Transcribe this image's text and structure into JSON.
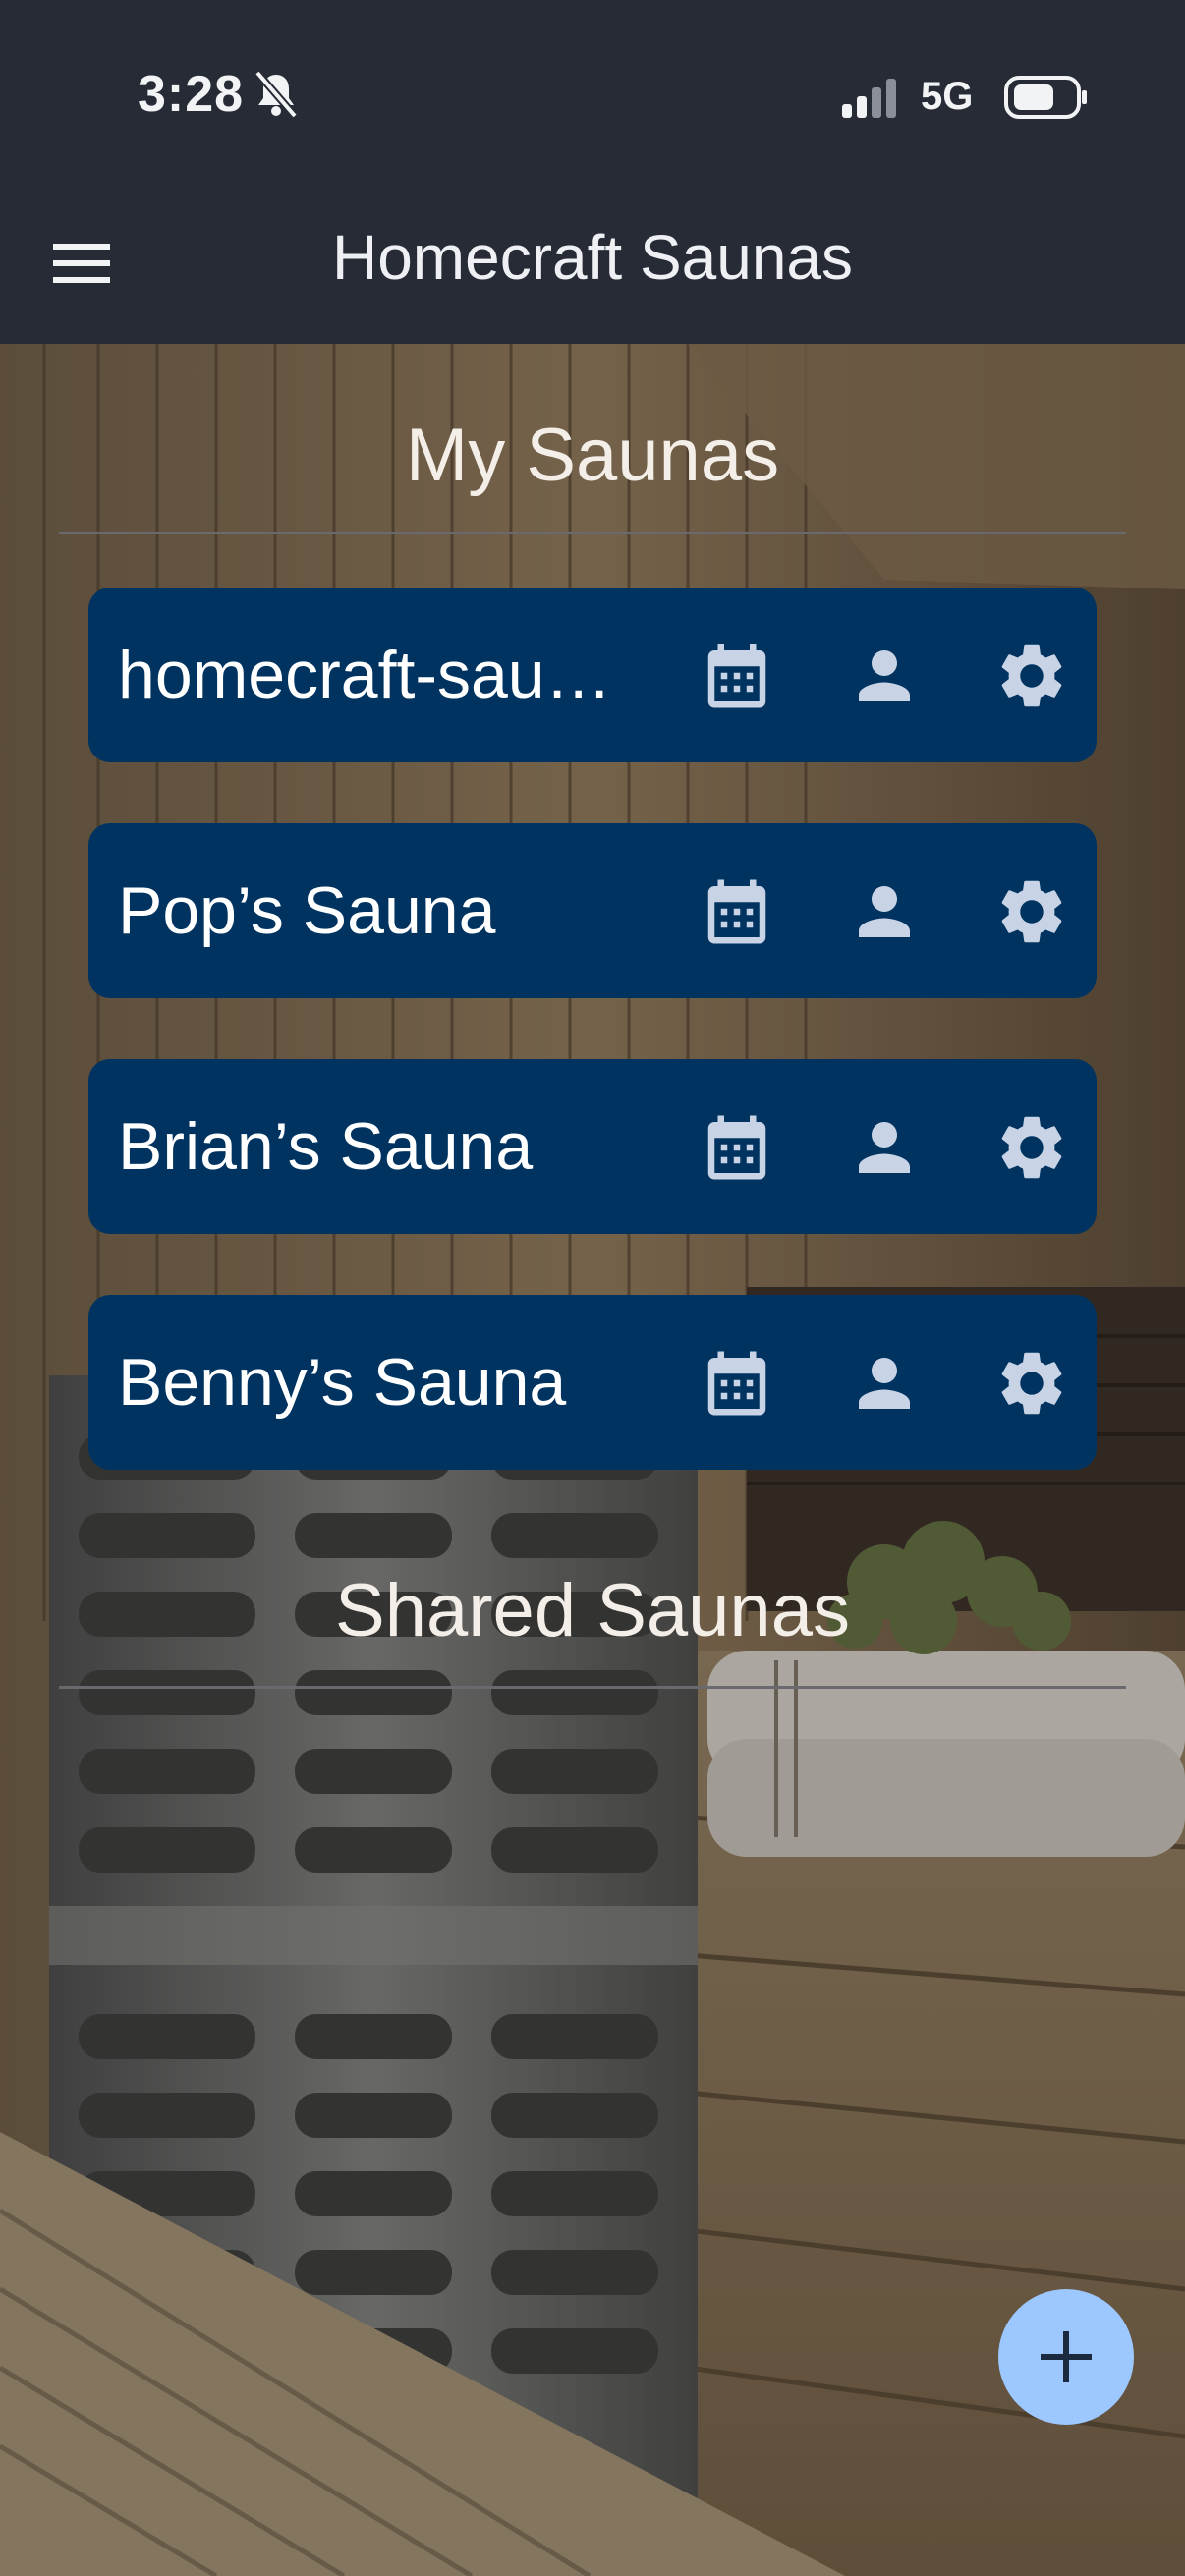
{
  "status_bar": {
    "time": "3:28",
    "network": "5G"
  },
  "app_bar": {
    "title": "Homecraft Saunas",
    "menu_icon": "hamburger-menu-icon"
  },
  "my_saunas": {
    "title": "My Saunas",
    "items": [
      {
        "name": "homecraft-sau…"
      },
      {
        "name": "Pop’s Sauna"
      },
      {
        "name": "Brian’s Sauna"
      },
      {
        "name": "Benny’s Sauna"
      }
    ]
  },
  "shared_saunas": {
    "title": "Shared Saunas"
  },
  "fab": {
    "icon": "plus-icon"
  },
  "colors": {
    "app_bar": "#262b36",
    "card": "#003360",
    "fab": "#9dc8ff",
    "icon": "#c8d4e6"
  }
}
